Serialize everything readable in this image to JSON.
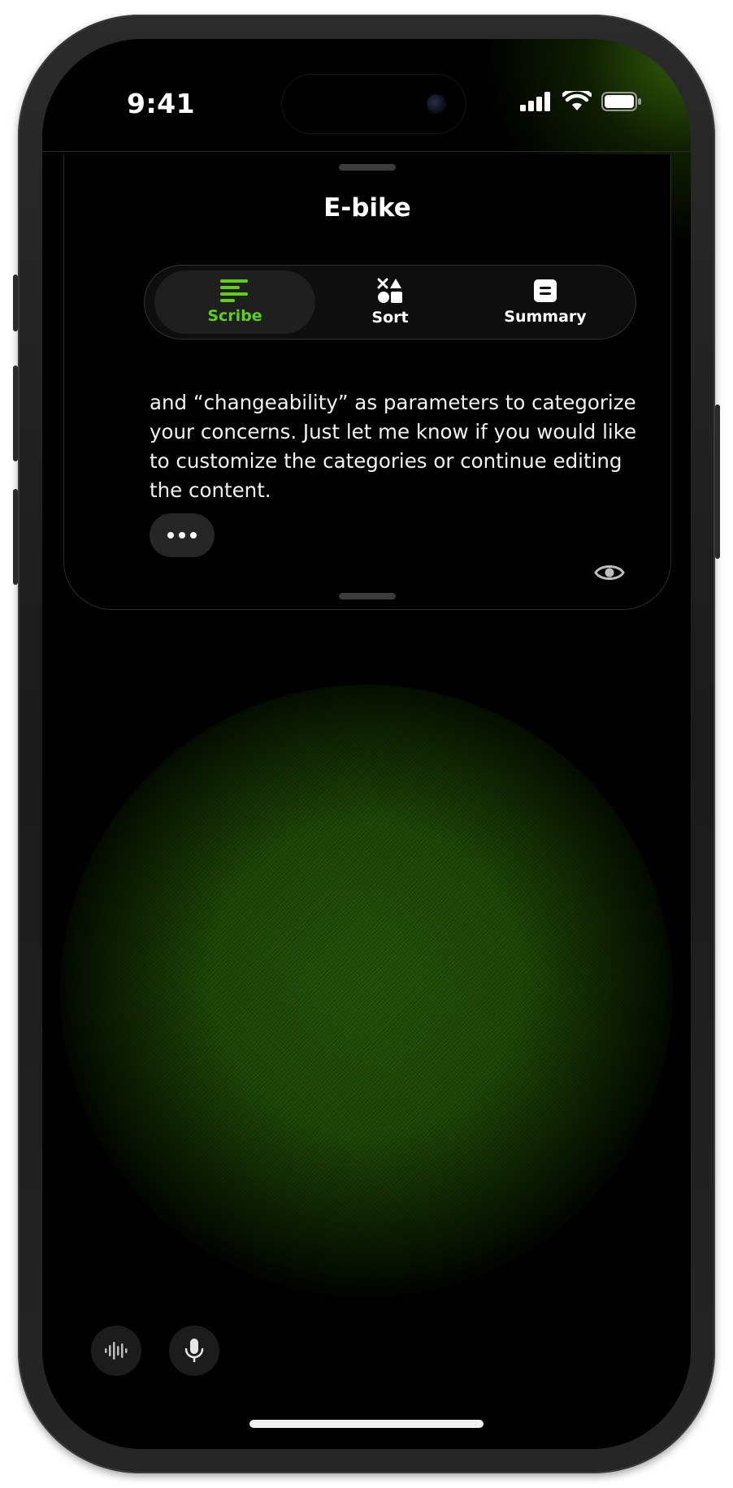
{
  "status_bar": {
    "time": "9:41"
  },
  "sheet": {
    "title": "E-bike",
    "tabs": [
      {
        "label": "Scribe",
        "icon": "lines-icon",
        "active": true
      },
      {
        "label": "Sort",
        "icon": "shapes-icon",
        "active": false
      },
      {
        "label": "Summary",
        "icon": "document-icon",
        "active": false
      }
    ],
    "message_lines": [
      "and “changeability” as parameters to categorize",
      "your concerns. Just let me know if you would like",
      "to customize the categories or continue editing",
      "the content."
    ]
  },
  "colors": {
    "accent": "#5fd019",
    "background": "#000000",
    "orb": "#2a5a0a"
  },
  "icons": {
    "more": "ellipsis-icon",
    "visibility": "eye-icon",
    "waveform": "waveform-icon",
    "microphone": "microphone-icon"
  }
}
